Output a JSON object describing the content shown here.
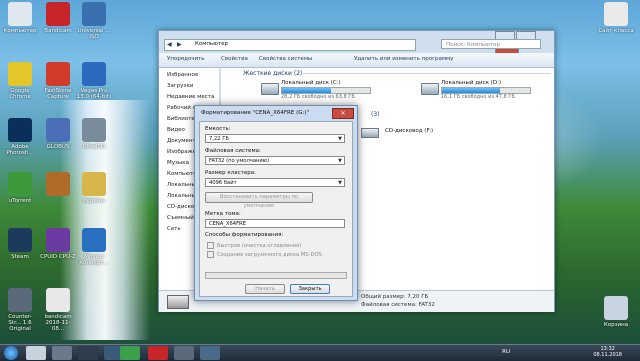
{
  "desktop": {
    "icons": [
      {
        "label": "Компьютер",
        "color": "#dfe8f0"
      },
      {
        "label": "Bandicam",
        "color": "#c8252a"
      },
      {
        "label": "Universal ... ISO",
        "color": "#3a6fb0"
      },
      {
        "label": "Google Chrome",
        "color": "#e4c62a"
      },
      {
        "label": "FastStone Capture",
        "color": "#d23b2b"
      },
      {
        "label": "Vegas Pro 13.0 (64-bit)",
        "color": "#2c6ac0"
      },
      {
        "label": "Adobe Photosh...",
        "color": "#0b2f5b"
      },
      {
        "label": "GLOBUS",
        "color": "#4a6fb6"
      },
      {
        "label": "UltraISO",
        "color": "#7a8b9b"
      },
      {
        "label": "uTorrent",
        "color": "#3c9a3c"
      },
      {
        "label": "",
        "color": "#b06a2a"
      },
      {
        "label": "скрины",
        "color": "#d9b64a"
      },
      {
        "label": "Steam",
        "color": "#1b3a5c"
      },
      {
        "label": "CPUID CPU-Z",
        "color": "#6a3aa0"
      },
      {
        "label": "Movavi Конверт...",
        "color": "#2a70c0"
      },
      {
        "label": "Counter-Str... 1.6 Original",
        "color": "#5a6a7a"
      },
      {
        "label": "bandicam 2018-11-08...",
        "color": "#e8e8e8"
      },
      {
        "label": "Сайт класса",
        "color": "#eaeaea"
      },
      {
        "label": "Корзина",
        "color": "#c8d4e0"
      }
    ]
  },
  "taskbar": {
    "lang": "RU",
    "time": "13:32",
    "date": "08.11.2018"
  },
  "explorer": {
    "address": "Компьютер",
    "search_placeholder": "Поиск: Компьютер",
    "toolbar": {
      "organize": "Упорядочить",
      "properties": "Свойства",
      "system_props": "Свойства системы",
      "uninstall": "Удалить или изменить программу"
    },
    "nav": [
      "Избранное",
      "Загрузки",
      "Недавние места",
      "Рабочий стол",
      "Библиотеки",
      "Видео",
      "Документы",
      "Изображения",
      "Музыка",
      "Компьютер",
      "Локальный...",
      "Локальный...",
      "CD-дисковод",
      "Съемный...",
      "Сеть"
    ],
    "section_hdd": "Жесткие диски (2)",
    "section_removable": "(3)",
    "drives": [
      {
        "name": "Локальный диск (C:)",
        "free": "28,2 ГБ свободно из 63,8 ГБ",
        "fill": 0.56
      },
      {
        "name": "Локальный диск (D:)",
        "free": "16,1 ГБ свободно из 47,8 ГБ",
        "fill": 0.66
      }
    ],
    "cd_drive": "CD-дисковод (F:)",
    "status_total": "Общий размер: 7,20 ГБ",
    "status_fs": "Файловая система: FAT32"
  },
  "dialog": {
    "title": "Форматирование \"CENA_X64FRE (G:)\"",
    "capacity_label": "Емкость:",
    "capacity_value": "7,22 ГБ",
    "fs_label": "Файловая система:",
    "fs_value": "FAT32 (по умолчанию)",
    "cluster_label": "Размер кластера:",
    "cluster_value": "4096 байт",
    "restore_btn": "Восстановить параметры по умолчанию",
    "volume_label": "Метка тома:",
    "volume_value": "CENA_X64FRE",
    "methods_label": "Способы форматирования:",
    "quick": "Быстрое (очистка оглавления)",
    "msdos": "Создание загрузочного диска MS-DOS",
    "start_btn": "Начать",
    "close_btn": "Закрыть"
  }
}
